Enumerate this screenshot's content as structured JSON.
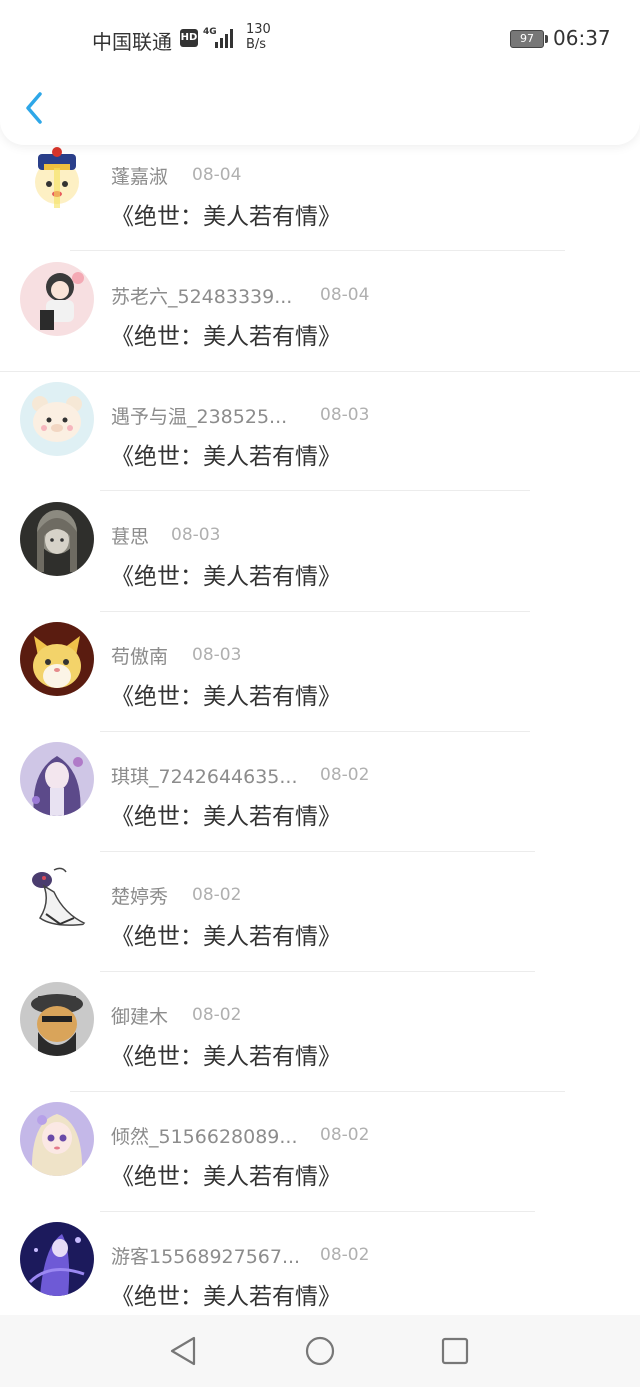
{
  "status_bar": {
    "carrier": "中国联通",
    "hd_badge": "HD",
    "network": "4G",
    "speed_value": "130",
    "speed_unit": "B/s",
    "battery": "97",
    "time": "06:37"
  },
  "header": {
    "back_icon": "chevron-left-icon",
    "accent_color": "#2ea7e8"
  },
  "items": [
    {
      "name": "蓬嘉淑",
      "date": "08-04",
      "message": "《绝世：美人若有情》"
    },
    {
      "name": "苏老六_52483339...",
      "date": "08-04",
      "message": "《绝世：美人若有情》"
    },
    {
      "name": "遇予与温_238525...",
      "date": "08-03",
      "message": "《绝世：美人若有情》"
    },
    {
      "name": "葚思",
      "date": "08-03",
      "message": "《绝世：美人若有情》"
    },
    {
      "name": "苟傲南",
      "date": "08-03",
      "message": "《绝世：美人若有情》"
    },
    {
      "name": "琪琪_7242644635...",
      "date": "08-02",
      "message": "《绝世：美人若有情》"
    },
    {
      "name": "楚婷秀",
      "date": "08-02",
      "message": "《绝世：美人若有情》"
    },
    {
      "name": "御建木",
      "date": "08-02",
      "message": "《绝世：美人若有情》"
    },
    {
      "name": "倾然_5156628089...",
      "date": "08-02",
      "message": "《绝世：美人若有情》"
    },
    {
      "name": "游客15568927567...",
      "date": "08-02",
      "message": "《绝世：美人若有情》"
    }
  ],
  "nav_bar": {
    "back": "triangle-back-icon",
    "home": "circle-home-icon",
    "recents": "square-recents-icon"
  }
}
